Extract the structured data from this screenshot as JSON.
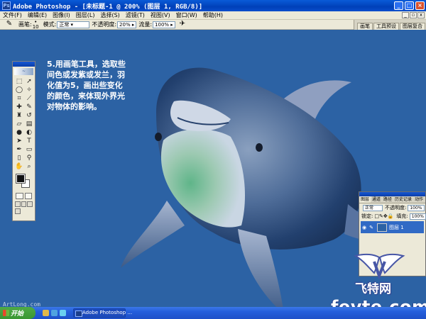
{
  "window": {
    "title": "Adobe Photoshop - [未标题-1 @ 200% (图层 1, RGB/8)]"
  },
  "menu": {
    "items": [
      "文件(F)",
      "编辑(E)",
      "图像(I)",
      "图层(L)",
      "选择(S)",
      "滤镜(T)",
      "视图(V)",
      "窗口(W)",
      "帮助(H)"
    ]
  },
  "options": {
    "brush_label": "画笔:",
    "brush_size": "10",
    "mode_label": "模式:",
    "mode_value": "正常",
    "opacity_label": "不透明度:",
    "opacity_value": "20%",
    "flow_label": "流量:",
    "flow_value": "100%",
    "well_tabs": [
      "画笔",
      "工具预设",
      "图层复合"
    ]
  },
  "instruction": {
    "lines": [
      "5.用画笔工具，选取些",
      "间色或发紫或发兰，羽",
      "化值为5，画出些变化",
      "的颜色，来体现外界光",
      "对物体的影响。"
    ]
  },
  "layers_panel": {
    "tabs": [
      "图层",
      "通道",
      "路径",
      "历史记录",
      "动作"
    ],
    "blend_mode": "正常",
    "opacity_label": "不透明度:",
    "opacity_value": "100%",
    "lock_label": "锁定:",
    "fill_label": "填充:",
    "fill_value": "100%",
    "layer_name": "图层 1"
  },
  "watermark": {
    "cn": "飞特网",
    "en": "fevte.com",
    "tray": "ArtLong.com"
  },
  "taskbar": {
    "start": "开始",
    "task": "Adobe Photoshop ..."
  },
  "colors": {
    "canvas_bg": "#2c62a4",
    "foreground": "#111111",
    "background": "#ffffff"
  }
}
